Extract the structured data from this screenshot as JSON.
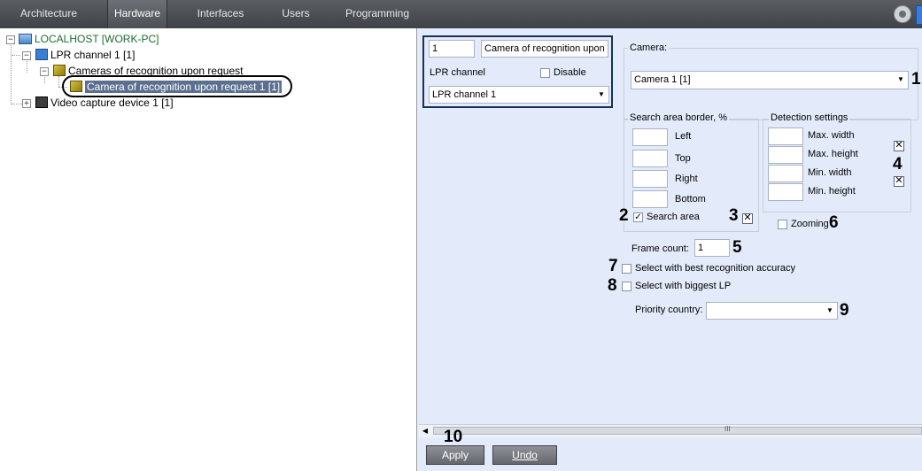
{
  "tabs": [
    {
      "label": "Architecture"
    },
    {
      "label": "Hardware"
    },
    {
      "label": "Interfaces"
    },
    {
      "label": "Users"
    },
    {
      "label": "Programming"
    }
  ],
  "tree": {
    "root": "LOCALHOST [WORK-PC]",
    "lpr": "LPR channel 1 [1]",
    "cameras_group": "Cameras of recognition upon request",
    "camera_item": "Camera of recognition upon request 1 [1]",
    "video": "Video capture device 1 [1]"
  },
  "object": {
    "id": "1",
    "name": "Camera of recognition upon re",
    "parent_label": "LPR channel",
    "disable_label": "Disable",
    "parent_value": "LPR channel 1"
  },
  "camera": {
    "group_label": "Camera:",
    "value": "Camera 1 [1]"
  },
  "search_area": {
    "group_label": "Search area border, %",
    "left": "Left",
    "top": "Top",
    "right": "Right",
    "bottom": "Bottom",
    "checkbox_label": "Search area"
  },
  "detection": {
    "group_label": "Detection settings",
    "max_width": "Max. width",
    "max_height": "Max. height",
    "min_width": "Min. width",
    "min_height": "Min. height",
    "zooming_label": "Zooming"
  },
  "frame_count": {
    "label": "Frame count:",
    "value": "1"
  },
  "options": {
    "best_accuracy": "Select with best recognition accuracy",
    "biggest_lp": "Select with biggest LP",
    "priority_label": "Priority country:"
  },
  "callouts": {
    "c1": "1",
    "c2": "2",
    "c3": "3",
    "c4": "4",
    "c5": "5",
    "c6": "6",
    "c7": "7",
    "c8": "8",
    "c9": "9",
    "c10": "10"
  },
  "buttons": {
    "apply": "Apply",
    "undo": "Undo"
  },
  "scrollbar": {
    "grip": "III"
  },
  "colors": {
    "panel_bg": "#e3ebfb",
    "tab_bar": "#4a4d52",
    "tree_text": "#000000",
    "root_text": "#1a6e2c"
  }
}
